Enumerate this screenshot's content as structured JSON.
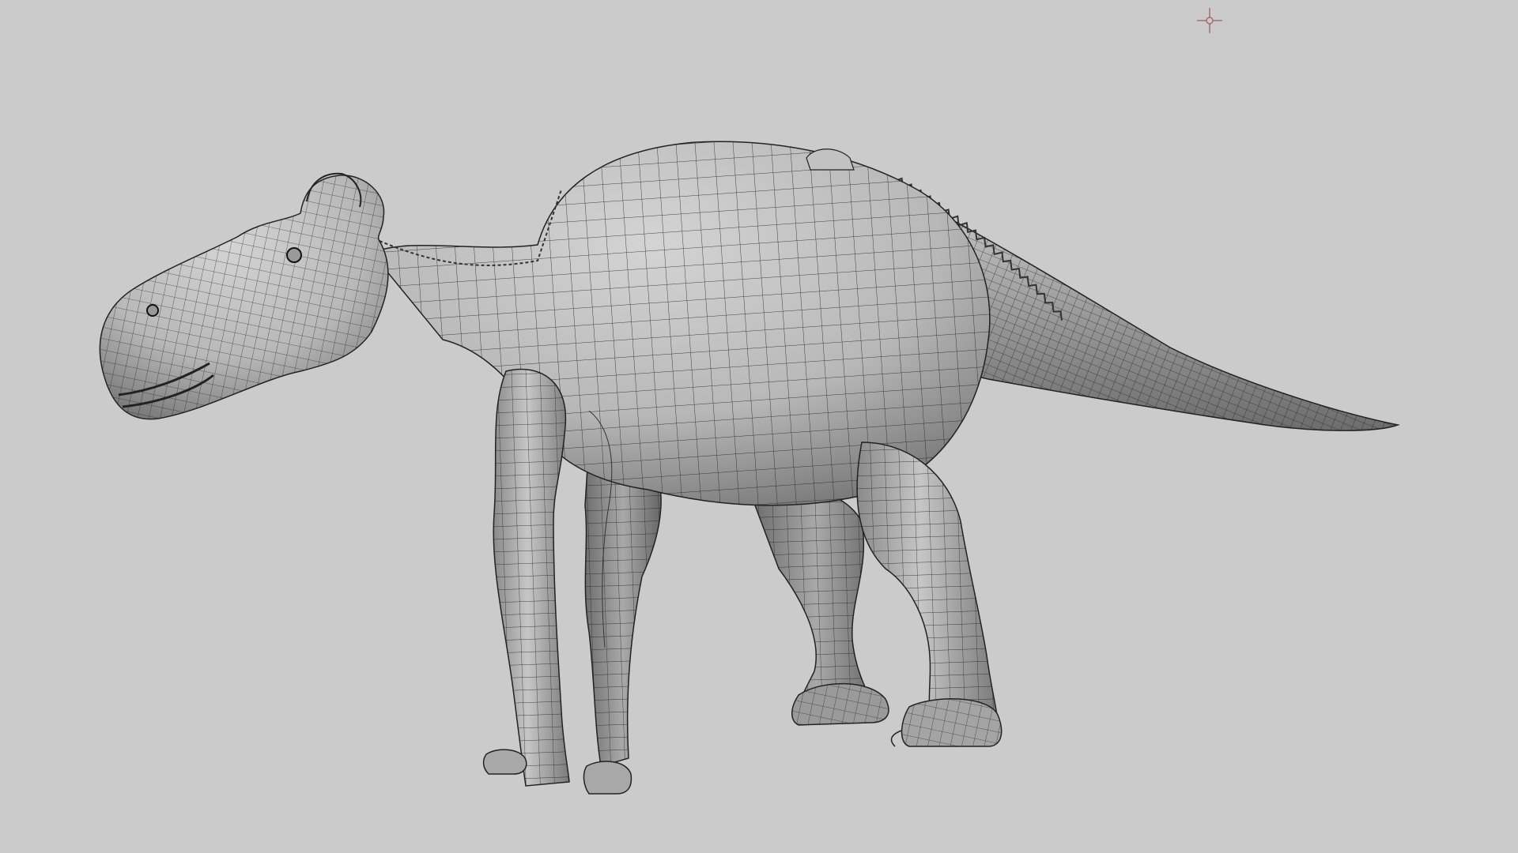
{
  "viewport": {
    "background_color": "#cbcbcb",
    "shading": "smooth-shaded-with-wireframe",
    "view": "perspective-side"
  },
  "model": {
    "type": "hadrosaur-sculpt-mesh",
    "base_color": "#bcbcbc",
    "shadow_color": "#5a5a5a",
    "wire_color": "#222222"
  },
  "gizmo": {
    "icon": "pivot-crosshair-icon",
    "color": "#a06a6a"
  }
}
